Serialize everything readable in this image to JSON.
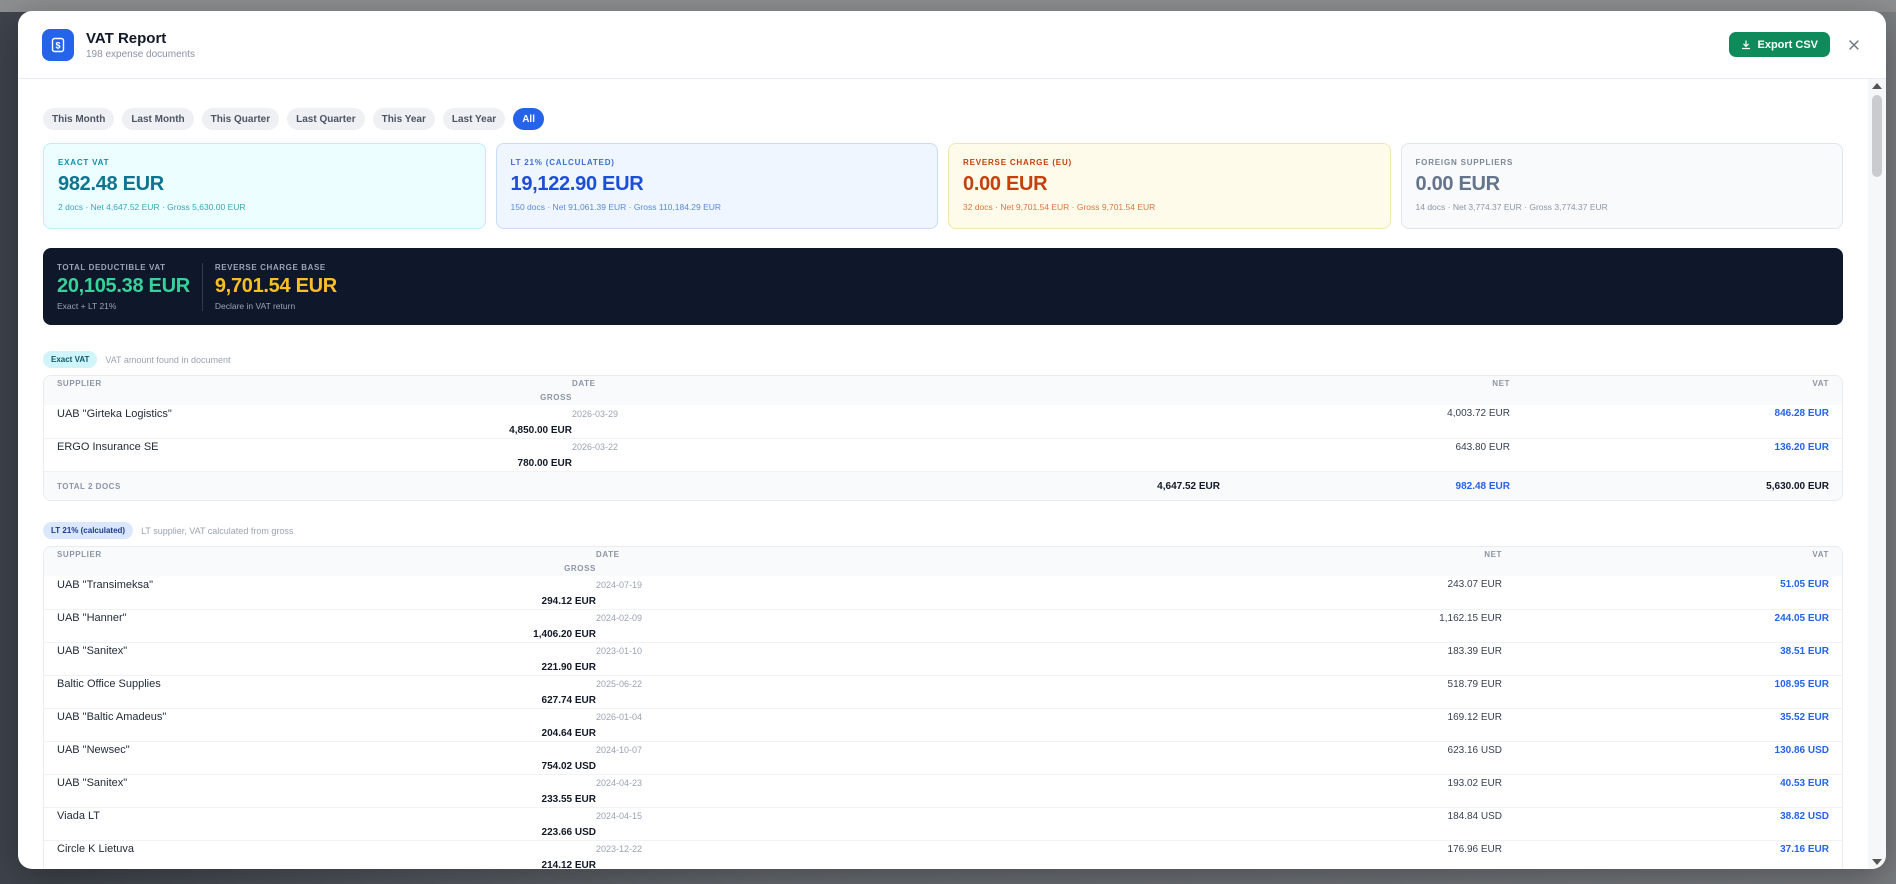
{
  "header": {
    "title": "VAT Report",
    "subtitle": "198 expense documents",
    "export_label": "Export CSV"
  },
  "filters": [
    {
      "label": "This Month",
      "active": false
    },
    {
      "label": "Last Month",
      "active": false
    },
    {
      "label": "This Quarter",
      "active": false
    },
    {
      "label": "Last Quarter",
      "active": false
    },
    {
      "label": "This Year",
      "active": false
    },
    {
      "label": "Last Year",
      "active": false
    },
    {
      "label": "All",
      "active": true
    }
  ],
  "cards": {
    "exact": {
      "label": "Exact VAT",
      "value": "982.48 EUR",
      "meta": "2 docs · Net 4,647.52 EUR · Gross 5,630.00 EUR"
    },
    "lt": {
      "label": "LT 21% (Calculated)",
      "value": "19,122.90 EUR",
      "meta": "150 docs · Net 91,061.39 EUR · Gross 110,184.29 EUR"
    },
    "rc": {
      "label": "Reverse Charge (EU)",
      "value": "0.00 EUR",
      "meta": "32 docs · Net 9,701.54 EUR · Gross 9,701.54 EUR"
    },
    "fs": {
      "label": "Foreign Suppliers",
      "value": "0.00 EUR",
      "meta": "14 docs · Net 3,774.37 EUR · Gross 3,774.37 EUR"
    }
  },
  "totals": {
    "deductible": {
      "label": "Total Deductible VAT",
      "value": "20,105.38 EUR",
      "note": "Exact + LT 21%"
    },
    "reverse": {
      "label": "Reverse Charge Base",
      "value": "9,701.54 EUR",
      "note": "Declare in VAT return"
    }
  },
  "colors": {
    "accent": "#2563eb",
    "export": "#0f8a5a",
    "dark_panel": "#0f172a",
    "green": "#34d399",
    "yellow": "#fbbf24"
  },
  "columns": {
    "supplier": "Supplier",
    "date": "Date",
    "net": "Net",
    "vat": "VAT",
    "gross": "Gross"
  },
  "exact_section": {
    "badge": "Exact VAT",
    "desc": "VAT amount found in document",
    "rows": [
      {
        "supplier": "UAB \"Girteka Logistics\"",
        "date": "2026-03-29",
        "net": "4,003.72 EUR",
        "vat": "846.28 EUR",
        "gross": "4,850.00 EUR"
      },
      {
        "supplier": "ERGO Insurance SE",
        "date": "2026-03-22",
        "net": "643.80 EUR",
        "vat": "136.20 EUR",
        "gross": "780.00 EUR"
      }
    ],
    "total": {
      "label": "Total 2 docs",
      "net": "4,647.52 EUR",
      "vat": "982.48 EUR",
      "gross": "5,630.00 EUR"
    }
  },
  "lt_section": {
    "badge": "LT 21% (calculated)",
    "desc": "LT supplier, VAT calculated from gross",
    "rows": [
      {
        "supplier": "UAB \"Transimeksa\"",
        "date": "2024-07-19",
        "net": "243.07 EUR",
        "vat": "51.05 EUR",
        "gross": "294.12 EUR"
      },
      {
        "supplier": "UAB \"Hanner\"",
        "date": "2024-02-09",
        "net": "1,162.15 EUR",
        "vat": "244.05 EUR",
        "gross": "1,406.20 EUR"
      },
      {
        "supplier": "UAB \"Sanitex\"",
        "date": "2023-01-10",
        "net": "183.39 EUR",
        "vat": "38.51 EUR",
        "gross": "221.90 EUR"
      },
      {
        "supplier": "Baltic Office Supplies",
        "date": "2025-06-22",
        "net": "518.79 EUR",
        "vat": "108.95 EUR",
        "gross": "627.74 EUR"
      },
      {
        "supplier": "UAB \"Baltic Amadeus\"",
        "date": "2026-01-04",
        "net": "169.12 EUR",
        "vat": "35.52 EUR",
        "gross": "204.64 EUR"
      },
      {
        "supplier": "UAB \"Newsec\"",
        "date": "2024-10-07",
        "net": "623.16 USD",
        "vat": "130.86 USD",
        "gross": "754.02 USD"
      },
      {
        "supplier": "UAB \"Sanitex\"",
        "date": "2024-04-23",
        "net": "193.02 EUR",
        "vat": "40.53 EUR",
        "gross": "233.55 EUR"
      },
      {
        "supplier": "Viada LT",
        "date": "2024-04-15",
        "net": "184.84 USD",
        "vat": "38.82 USD",
        "gross": "223.66 USD"
      },
      {
        "supplier": "Circle K Lietuva",
        "date": "2023-12-22",
        "net": "176.96 EUR",
        "vat": "37.16 EUR",
        "gross": "214.12 EUR"
      }
    ]
  }
}
